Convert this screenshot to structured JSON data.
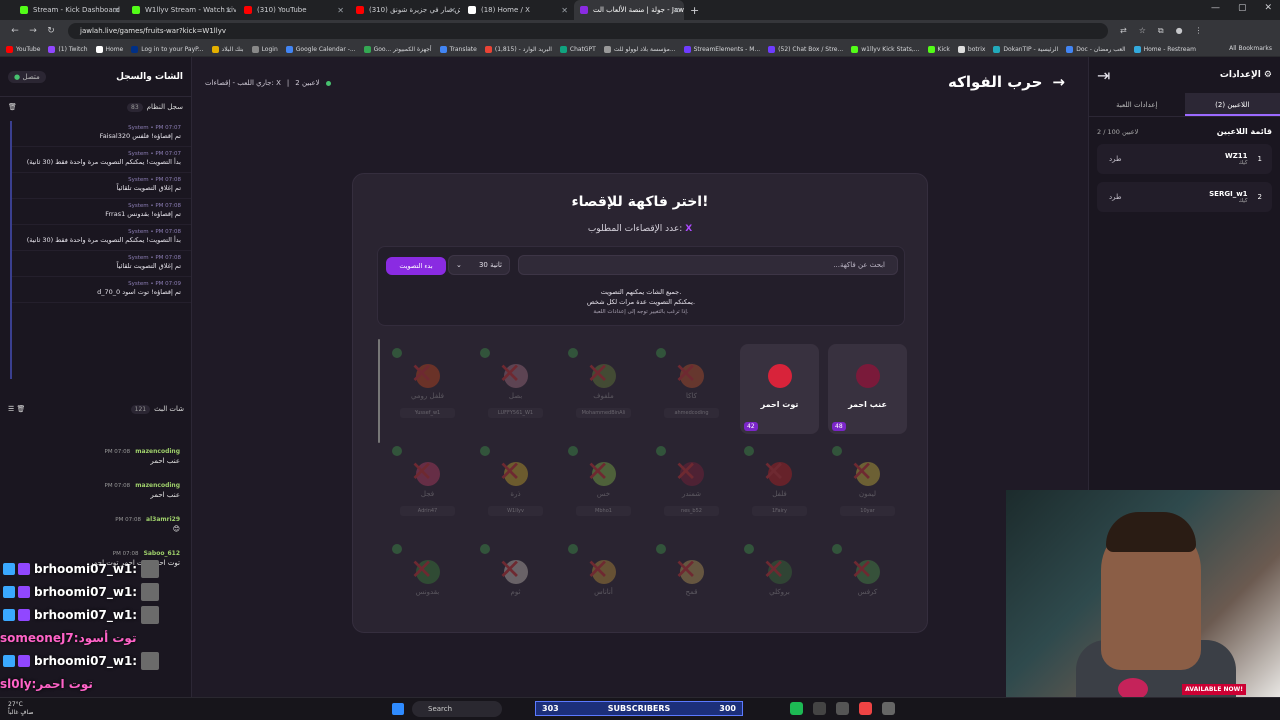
{
  "browser": {
    "tabs": [
      {
        "label": "Stream - Kick Dashboard",
        "color": "#53fc18"
      },
      {
        "label": "W1llyv Stream - Watch Live on",
        "color": "#53fc18"
      },
      {
        "label": "(310) YouTube",
        "color": "#ff0000"
      },
      {
        "label": "(310) وش صار في جزيرة شونق",
        "color": "#ff0000"
      },
      {
        "label": "(18) Home / X",
        "color": "#ffffff"
      },
      {
        "label": "جولة | منصة الألعاب الت - Jawlah",
        "color": "#8a2be2",
        "active": true
      }
    ],
    "url": "jawlah.live/games/fruits-war?kick=W1llyv",
    "bookmarks": [
      "YouTube",
      "(1) Twitch",
      "Home",
      "Log in to your PayP...",
      "بنك البلاد",
      "Login",
      "Google Calendar -...",
      "Goo... أجهزة الكمبيوتر",
      "Translate",
      "البريد الوارد - (1,815)",
      "ChatGPT",
      "مؤسسة بلاد لوولو للت...",
      "StreamElements - M...",
      "(52) Chat Box / Stre...",
      "w1llyv Kick Stats,...",
      "Kick",
      "botrix",
      "DokanTIP - الرئيسية",
      "Doc - العب رمضان",
      "Home - Restream"
    ],
    "all_bookmarks": "All Bookmarks"
  },
  "chat_panel": {
    "title": "الشات والسجل",
    "online": "متصل",
    "system_log_title": "سجل النظام",
    "system_log_count": "83",
    "system_messages": [
      {
        "meta": "System • PM 07:07",
        "text": "Faisal320 تم إقصاؤه! فلفس"
      },
      {
        "meta": "System • PM 07:07",
        "text": "بدأ التصويت! يمكنكم التصويت مرة واحدة فقط (30 ثانية)"
      },
      {
        "meta": "System • PM 07:08",
        "text": "تم إغلاق التصويت تلقائياً"
      },
      {
        "meta": "System • PM 07:08",
        "text": "Frras1 تم إقصاؤه! بقدونس"
      },
      {
        "meta": "System • PM 07:08",
        "text": "بدأ التصويت! يمكنكم التصويت مرة واحدة فقط (30 ثانية)"
      },
      {
        "meta": "System • PM 07:08",
        "text": "تم إغلاق التصويت تلقائياً"
      },
      {
        "meta": "System • PM 07:09",
        "text": "d_70_0 تم إقصاؤه! توت اسود"
      }
    ],
    "live_chat_title": "شات البث",
    "live_chat_count": "121",
    "chat_messages": [
      {
        "user": "mazencoding",
        "time": "PM 07:08",
        "msg": "عنب احمر"
      },
      {
        "user": "mazencoding",
        "time": "PM 07:08",
        "msg": "عنب احمر"
      },
      {
        "user": "al3amri29",
        "time": "PM 07:08",
        "msg": "😊"
      },
      {
        "user": "Saboo_612",
        "time": "PM 07:08",
        "msg": "توت احمر توت احمر توت احمر"
      }
    ]
  },
  "overlay_chat": [
    {
      "user": "brhoomi07_w1",
      "msg": ""
    },
    {
      "user": "brhoomi07_w1",
      "msg": ""
    },
    {
      "user": "brhoomi07_w1",
      "msg": ""
    },
    {
      "user": "someoneJ7",
      "msg": "توت أسود",
      "pink": true
    },
    {
      "user": "brhoomi07_w1",
      "msg": ""
    },
    {
      "user": "sl0ly",
      "msg": "توت احمر",
      "pink": true
    }
  ],
  "game": {
    "players_online": "2 لاعبين",
    "status": "جاري اللعب - إقصاءات: X",
    "title": "حرب الفواكه",
    "modal": {
      "title": "اختر فاكهة للإقصاء!",
      "subtitle": "عدد الإقصاءات المطلوب:",
      "subtitle_value": "X",
      "search_placeholder": "ابحث عن فاكهة...",
      "timer": "30 ثانية",
      "start_vote": "بدء التصويت",
      "note1": "جميع الشات يمكنهم التصويت.",
      "note2": "يمكنكم التصويت عدة مرات لكل شخص.",
      "note3": "إذا ترغب بالتغيير توجه إلى إعدادات اللعبة."
    },
    "fruit_rows": [
      [
        {
          "name": "عنب احمر",
          "votes": "48",
          "color": "#7a1a3a",
          "active": true
        },
        {
          "name": "توت احمر",
          "votes": "42",
          "color": "#d8233a",
          "active": true
        },
        {
          "name": "كاكا",
          "player": "ahmedcoding",
          "color": "#c9562a"
        },
        {
          "name": "ملفوف",
          "player": "MohammedBinAli",
          "color": "#6d8a3a"
        },
        {
          "name": "بصل",
          "player": "LUFFY561_W1",
          "color": "#b07a8a"
        },
        {
          "name": "فلفل رومي",
          "player": "Yussef_w1",
          "color": "#d24a1a"
        }
      ],
      [
        {
          "name": "ليمون",
          "player": "10yar",
          "color": "#d9c33a"
        },
        {
          "name": "فلفل",
          "player": "1Fairy",
          "color": "#c82020"
        },
        {
          "name": "شمندر",
          "player": "nes_b52",
          "color": "#8a1f3a"
        },
        {
          "name": "خس",
          "player": "Mbho1",
          "color": "#8ac44a"
        },
        {
          "name": "ذرة",
          "player": "W1llyv",
          "color": "#d8b42a"
        },
        {
          "name": "فجل",
          "player": "Adrin47",
          "color": "#c8406a"
        }
      ],
      [
        {
          "name": "كرفس",
          "player": "",
          "color": "#4a9a4a"
        },
        {
          "name": "بروكلي",
          "player": "",
          "color": "#3a7a3a"
        },
        {
          "name": "قمح",
          "player": "",
          "color": "#c8a85a"
        },
        {
          "name": "أناناس",
          "player": "",
          "color": "#c89a3a"
        },
        {
          "name": "ثوم",
          "player": "",
          "color": "#d0c8c0"
        },
        {
          "name": "بقدونس",
          "player": "",
          "color": "#3a8a3a"
        }
      ]
    ]
  },
  "settings": {
    "title": "الإعدادات",
    "tab_players": "اللاعبين (2)",
    "tab_game": "إعدادات اللعبة",
    "players_list_title": "قائمة اللاعبين",
    "players_count": "2 / 100 لاعبين",
    "kick_label": "طرد",
    "players": [
      {
        "num": "1",
        "name": "WZ11",
        "platform": "كيك"
      },
      {
        "num": "2",
        "name": "SERGI_w1",
        "platform": "كيك"
      }
    ]
  },
  "stream_overlay": {
    "subs_left": "303",
    "subs_label": "SUBSCRIBERS",
    "subs_right": "300",
    "available": "AVAILABLE NOW!"
  },
  "taskbar": {
    "weather_temp": "27°C",
    "weather_desc": "صافٍ غالباً",
    "search": "Search"
  }
}
